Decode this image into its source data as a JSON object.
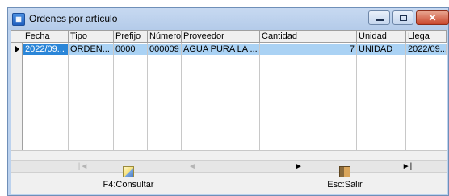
{
  "window": {
    "title": "Ordenes por artículo",
    "icon": "app-icon",
    "controls": {
      "minimize": "minimize-icon",
      "maximize": "maximize-icon",
      "close": "close-icon"
    }
  },
  "grid": {
    "columns": [
      "Fecha",
      "Tipo",
      "Prefijo",
      "Número",
      "Proveedor",
      "Cantidad",
      "Unidad",
      "Llega"
    ],
    "rows": [
      {
        "fecha": "2022/09...",
        "tipo": "ORDEN...",
        "prefijo": "0000",
        "numero": "000009",
        "proveedor": "AGUA PURA LA ...",
        "cantidad": "7",
        "unidad": "UNIDAD",
        "llega": "2022/09..."
      }
    ]
  },
  "navigator": {
    "first": "|◄",
    "prior": "◄",
    "next": "►",
    "last": "►|"
  },
  "buttons": {
    "consultar": "F4:Consultar",
    "salir": "Esc:Salir"
  },
  "colors": {
    "selection": "#2b86d8",
    "row_highlight": "#aad2f4",
    "titlebar": "#bcd2ee"
  }
}
